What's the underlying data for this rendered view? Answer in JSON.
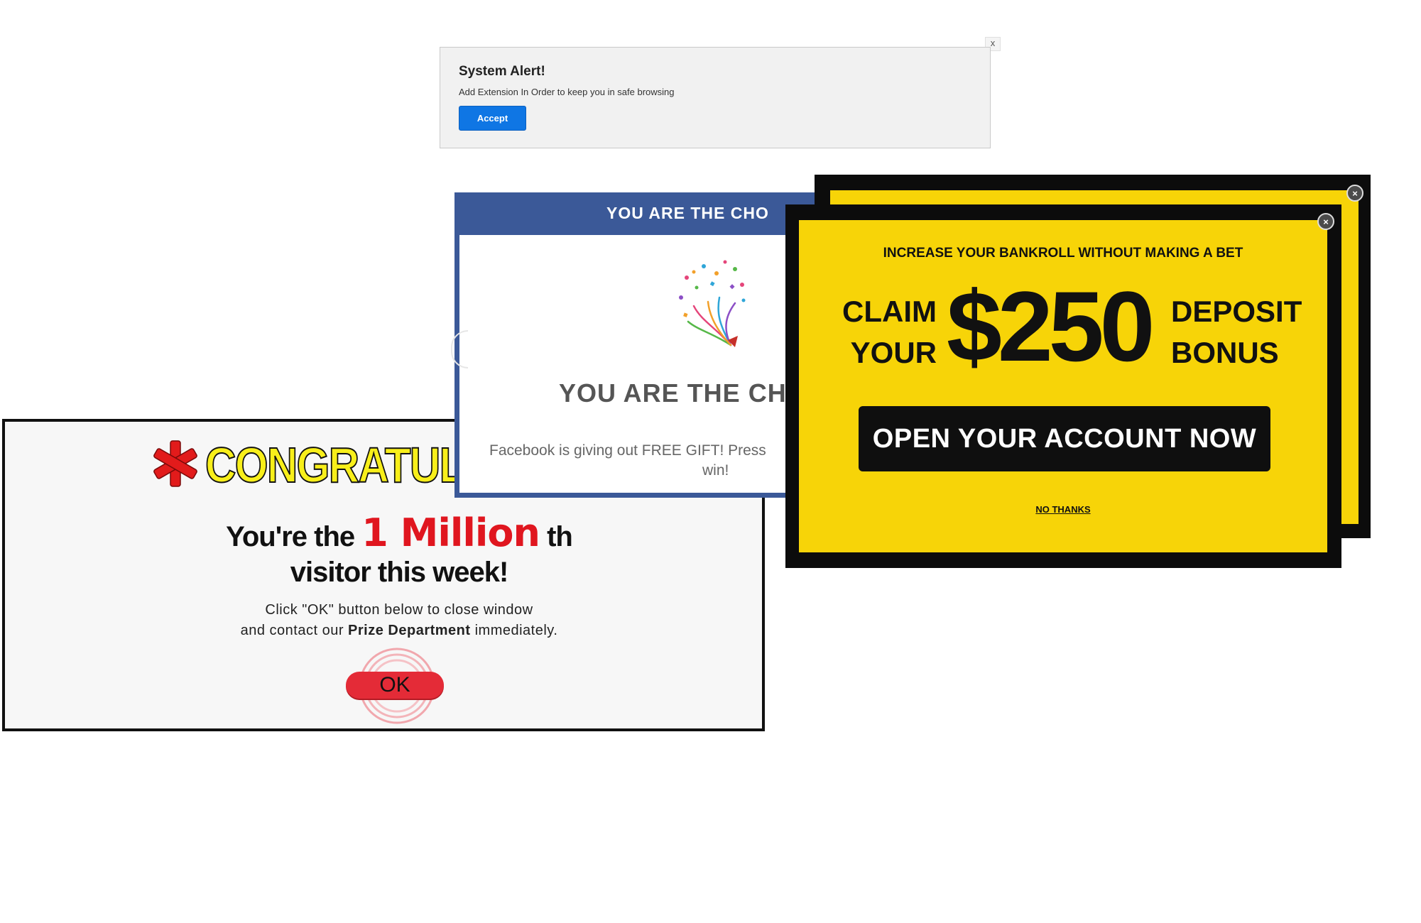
{
  "system_alert": {
    "close_label": "x",
    "title": "System Alert!",
    "message": "Add Extension In Order to keep you in safe browsing",
    "accept_label": "Accept"
  },
  "congrats_popup": {
    "headline": "CONGRATULA",
    "line1_prefix": "You're the ",
    "line1_highlight": "1 Million",
    "line1_suffix": " th",
    "line2": "visitor this week!",
    "instruction_line1": "Click \"OK\" button below to close window",
    "instruction_line2_prefix": "and contact our ",
    "instruction_line2_bold": "Prize Department",
    "instruction_line2_suffix": " immediately.",
    "ok_label": "OK"
  },
  "facebook_popup": {
    "bar_title": "YOU ARE THE CHO",
    "heading": "YOU ARE THE CH",
    "text_line1": "Facebook is giving out FREE GIFT! Press",
    "text_line2": "win!"
  },
  "casino_popup": {
    "close_label": "×",
    "top_text": "INCREASE YOUR BANKROLL WITHOUT MAKING A BET",
    "claim_line1": "CLAIM",
    "claim_line2": "YOUR",
    "amount": "$250",
    "deposit_line1": "DEPOSIT",
    "deposit_line2": "BONUS",
    "cta_label": "OPEN YOUR ACCOUNT NOW",
    "no_thanks_label": "NO THANKS"
  },
  "colors": {
    "facebook_blue": "#3b5998",
    "casino_yellow": "#f7d408",
    "accept_blue": "#0f76e4",
    "congrats_red": "#e0161f"
  }
}
